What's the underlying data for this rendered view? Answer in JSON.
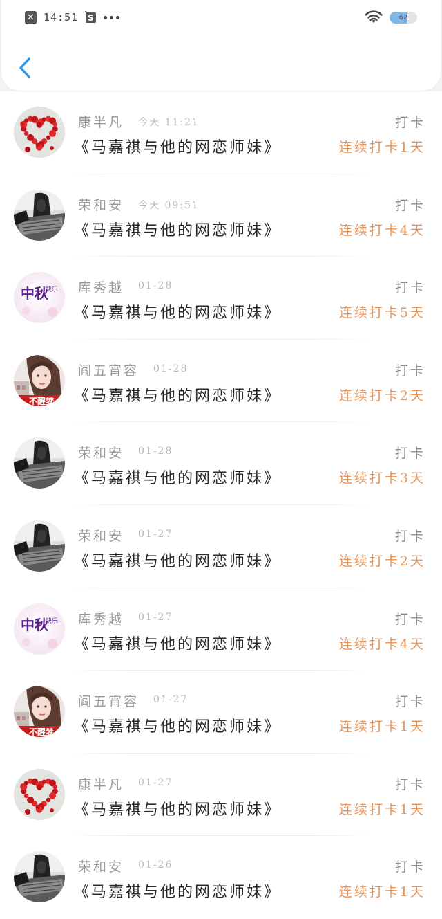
{
  "status_bar": {
    "time": "14:51",
    "battery": "62",
    "battery_level_pct": 62
  },
  "header": {
    "back_icon": "chevron-left-icon",
    "accent_color": "#2a9be8"
  },
  "colors": {
    "streak": "#e8955a",
    "name": "#9a9a9a",
    "title": "#2a2a2a"
  },
  "entries": [
    {
      "name": "康半凡",
      "time": "今天 11:21",
      "title": "《马嘉祺与他的网恋师妹》",
      "action": "打卡",
      "streak": "连续打卡1天",
      "avatar": "heart"
    },
    {
      "name": "荣和安",
      "time": "今天 09:51",
      "title": "《马嘉祺与他的网恋师妹》",
      "action": "打卡",
      "streak": "连续打卡4天",
      "avatar": "bw"
    },
    {
      "name": "库秀越",
      "time": "01-28",
      "title": "《马嘉祺与他的网恋师妹》",
      "action": "打卡",
      "streak": "连续打卡5天",
      "avatar": "mid-autumn"
    },
    {
      "name": "阎五宵容",
      "time": "01-28",
      "title": "《马嘉祺与他的网恋师妹》",
      "action": "打卡",
      "streak": "连续打卡2天",
      "avatar": "girl"
    },
    {
      "name": "荣和安",
      "time": "01-28",
      "title": "《马嘉祺与他的网恋师妹》",
      "action": "打卡",
      "streak": "连续打卡3天",
      "avatar": "bw"
    },
    {
      "name": "荣和安",
      "time": "01-27",
      "title": "《马嘉祺与他的网恋师妹》",
      "action": "打卡",
      "streak": "连续打卡2天",
      "avatar": "bw"
    },
    {
      "name": "库秀越",
      "time": "01-27",
      "title": "《马嘉祺与他的网恋师妹》",
      "action": "打卡",
      "streak": "连续打卡4天",
      "avatar": "mid-autumn"
    },
    {
      "name": "阎五宵容",
      "time": "01-27",
      "title": "《马嘉祺与他的网恋师妹》",
      "action": "打卡",
      "streak": "连续打卡1天",
      "avatar": "girl"
    },
    {
      "name": "康半凡",
      "time": "01-27",
      "title": "《马嘉祺与他的网恋师妹》",
      "action": "打卡",
      "streak": "连续打卡1天",
      "avatar": "heart"
    },
    {
      "name": "荣和安",
      "time": "01-26",
      "title": "《马嘉祺与他的网恋师妹》",
      "action": "打卡",
      "streak": "连续打卡1天",
      "avatar": "bw"
    }
  ],
  "avatar_texts": {
    "mid_autumn_big": "中秋",
    "mid_autumn_small": "快乐",
    "girl_banner": "不醒梦"
  }
}
